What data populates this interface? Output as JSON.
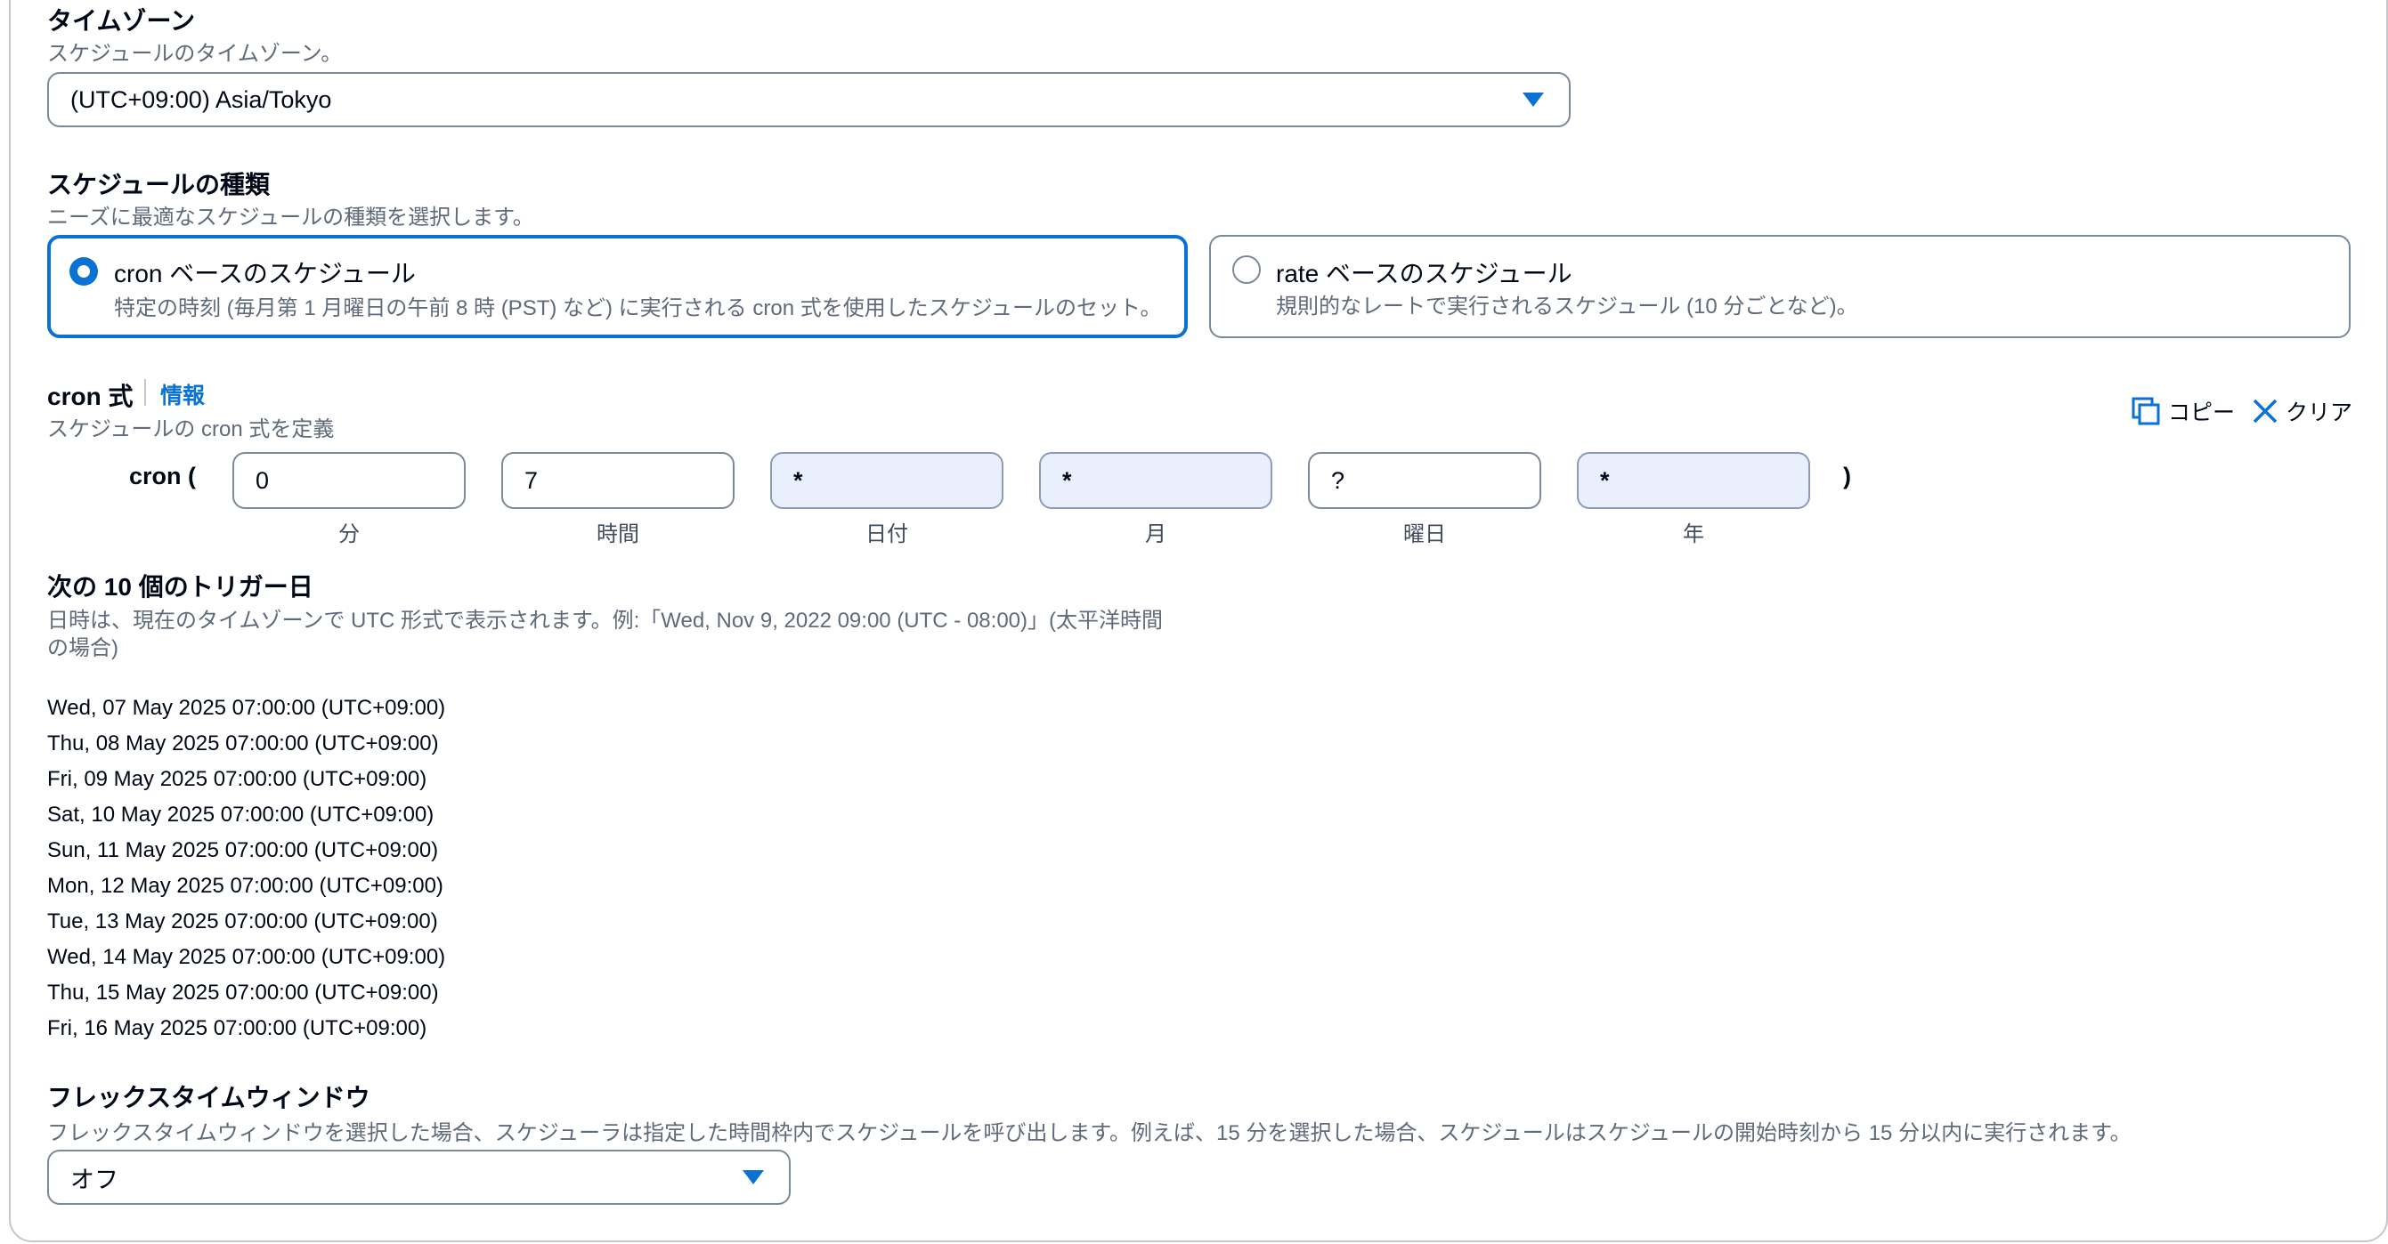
{
  "timezone": {
    "label": "タイムゾーン",
    "description": "スケジュールのタイムゾーン。",
    "value": "(UTC+09:00) Asia/Tokyo"
  },
  "schedule_type": {
    "label": "スケジュールの種類",
    "description": "ニーズに最適なスケジュールの種類を選択します。",
    "options": [
      {
        "title": "cron ベースのスケジュール",
        "description": "特定の時刻 (毎月第 1 月曜日の午前 8 時 (PST) など) に実行される cron 式を使用したスケジュールのセット。",
        "selected": true
      },
      {
        "title": "rate ベースのスケジュール",
        "description": "規則的なレートで実行されるスケジュール (10 分ごとなど)。",
        "selected": false
      }
    ]
  },
  "cron": {
    "label": "cron 式",
    "info_link": "情報",
    "description": "スケジュールの cron 式を定義",
    "copy_label": "コピー",
    "clear_label": "クリア",
    "prefix": "cron (",
    "suffix": ")",
    "fields": [
      {
        "value": "0",
        "caption": "分"
      },
      {
        "value": "7",
        "caption": "時間"
      },
      {
        "value": "*",
        "caption": "日付"
      },
      {
        "value": "*",
        "caption": "月"
      },
      {
        "value": "?",
        "caption": "曜日"
      },
      {
        "value": "*",
        "caption": "年"
      }
    ]
  },
  "triggers": {
    "label": "次の 10 個のトリガー日",
    "description_line1": "日時は、現在のタイムゾーンで UTC 形式で表示されます。例:「Wed, Nov 9, 2022 09:00 (UTC - 08:00)」(太平洋時間",
    "description_line2": "の場合)",
    "dates": [
      "Wed, 07 May 2025 07:00:00 (UTC+09:00)",
      "Thu, 08 May 2025 07:00:00 (UTC+09:00)",
      "Fri, 09 May 2025 07:00:00 (UTC+09:00)",
      "Sat, 10 May 2025 07:00:00 (UTC+09:00)",
      "Sun, 11 May 2025 07:00:00 (UTC+09:00)",
      "Mon, 12 May 2025 07:00:00 (UTC+09:00)",
      "Tue, 13 May 2025 07:00:00 (UTC+09:00)",
      "Wed, 14 May 2025 07:00:00 (UTC+09:00)",
      "Thu, 15 May 2025 07:00:00 (UTC+09:00)",
      "Fri, 16 May 2025 07:00:00 (UTC+09:00)"
    ]
  },
  "flex_window": {
    "label": "フレックスタイムウィンドウ",
    "description": "フレックスタイムウィンドウを選択した場合、スケジューラは指定した時間枠内でスケジュールを呼び出します。例えば、15 分を選択した場合、スケジュールはスケジュールの開始時刻から 15 分以内に実行されます。",
    "value": "オフ"
  },
  "colors": {
    "accent": "#0972d3",
    "text": "#000716",
    "muted": "#5f6b7a",
    "border": "#7d8998",
    "disabled_bg": "#e9effd"
  },
  "icons": {
    "copy": "copy-icon",
    "clear": "close-icon",
    "dropdown": "caret-down-icon"
  }
}
